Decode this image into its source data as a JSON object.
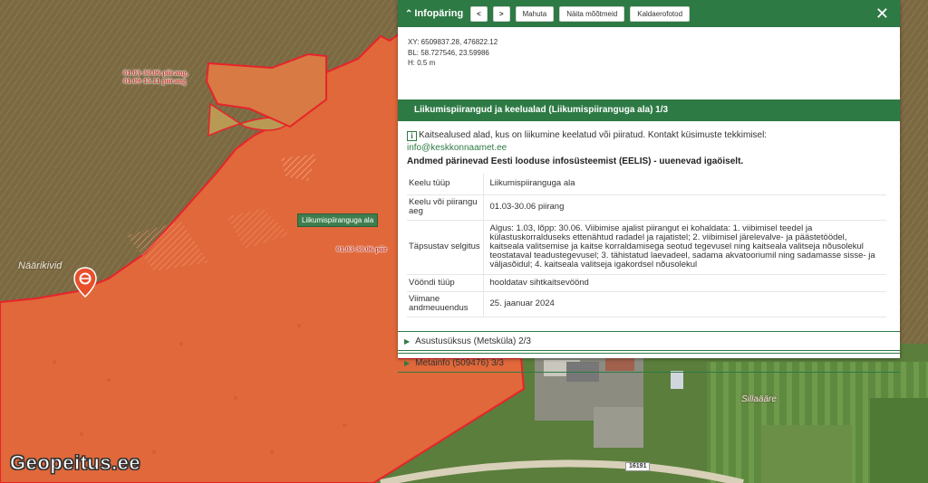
{
  "map": {
    "place_label_1": "Näärikivid",
    "place_label_2": "Sillaääre",
    "zone_label_1_line1": "01.03-30.06 piirang,",
    "zone_label_1_line2": "01.09-15.11 piirang",
    "zone_label_2": "01.03-30.06 piir",
    "tooltip": "Liikumispiiranguga ala",
    "road_number": "16191",
    "brand": "Geopeitus.ee",
    "colors": {
      "restriction_fill": "#e0683a",
      "restriction_border": "#e8232a",
      "water": "#7d6a45",
      "panel_green": "#2e7a45"
    }
  },
  "panel": {
    "title": "Infopäring",
    "title_icon": "chevron-up-icon",
    "buttons": {
      "prev": "<",
      "next": ">",
      "mahuta": "Mahuta",
      "measurements": "Näita mõõtmeid",
      "aerial": "Kaldaerofotod"
    },
    "close": "✕",
    "coords": {
      "xy": "XY: 6509837.28, 476822.12",
      "bl": "BL: 58.727546, 23.59986",
      "h": "H: 0.5 m"
    },
    "section_title": "Liikumispiirangud ja keelualad (Liikumispiiranguga ala) 1/3",
    "info_icon_glyph": "i",
    "info_text": "Kaitsealused alad, kus on liikumine keelatud või piiratud. Kontakt küsimuste tekkimisel:",
    "info_email": "info@keskkonnaamet.ee",
    "info_source": "Andmed pärinevad Eesti looduse infosüsteemist (EELIS) - uuenevad igaöiselt.",
    "attributes": [
      {
        "key": "Keelu tüüp",
        "value": "Liikumispiiranguga ala"
      },
      {
        "key": "Keelu või piirangu aeg",
        "value": "01.03-30.06 piirang"
      },
      {
        "key": "Täpsustav selgitus",
        "value": "Algus: 1.03, lõpp: 30.06. Viibimise ajalist piirangut ei kohaldata: 1. viibimisel teedel ja külastuskorralduseks ettenähtud radadel ja rajatistel; 2. viibimisel järelevalve- ja päästetöödel, kaitseala valitsemise ja kaitse korraldamisega seotud tegevusel ning kaitseala valitseja nõusolekul teostataval teadustegevusel; 3. tähistatud laevadeel, sadama akvatooriumil ning sadamasse sisse- ja väljasõidul; 4. kaitseala valitseja igakordsel nõusolekul"
      },
      {
        "key": "Vööndi tüüp",
        "value": "hooldatav sihtkaitsevöönd"
      },
      {
        "key": "Viimane andmeuuendus",
        "value": "25. jaanuar 2024"
      }
    ],
    "collapsed_sections": [
      {
        "label": "Asustusüksus (Metsküla) 2/3"
      },
      {
        "label": "Metainfo (509476) 3/3"
      }
    ]
  }
}
